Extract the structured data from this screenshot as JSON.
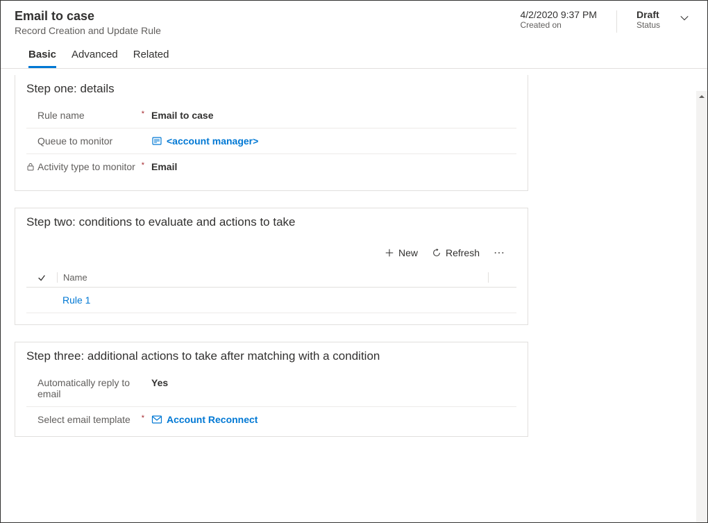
{
  "header": {
    "title": "Email to case",
    "subtitle": "Record Creation and Update Rule",
    "created_on_value": "4/2/2020 9:37 PM",
    "created_on_label": "Created on",
    "status_value": "Draft",
    "status_label": "Status"
  },
  "tabs": {
    "basic": "Basic",
    "advanced": "Advanced",
    "related": "Related"
  },
  "step1": {
    "title": "Step one: details",
    "rule_name_label": "Rule name",
    "rule_name_value": "Email to case",
    "queue_label": "Queue to monitor",
    "queue_value": "<account manager>",
    "activity_label": "Activity type to monitor",
    "activity_value": "Email"
  },
  "step2": {
    "title": "Step two: conditions to evaluate and actions to take",
    "toolbar": {
      "new": "New",
      "refresh": "Refresh"
    },
    "grid": {
      "header_name": "Name",
      "rows": [
        {
          "name": "Rule 1"
        }
      ]
    }
  },
  "step3": {
    "title": "Step three: additional actions to take after matching with a condition",
    "auto_reply_label": "Automatically reply to email",
    "auto_reply_value": "Yes",
    "template_label": "Select email template",
    "template_value": "Account Reconnect"
  }
}
